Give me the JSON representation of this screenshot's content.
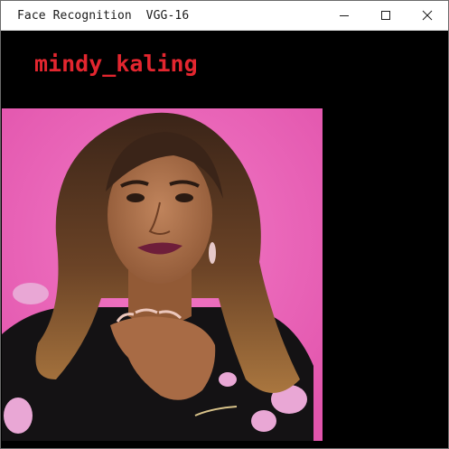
{
  "window": {
    "title": "Face Recognition  VGG-16",
    "controls": [
      "minimize-icon",
      "maximize-icon",
      "close-icon"
    ]
  },
  "prediction": {
    "label": "mindy_kaling",
    "color": "#e3262f"
  },
  "photo": {
    "background_color": "#ea5fb8",
    "icon": "portrait-photo"
  }
}
